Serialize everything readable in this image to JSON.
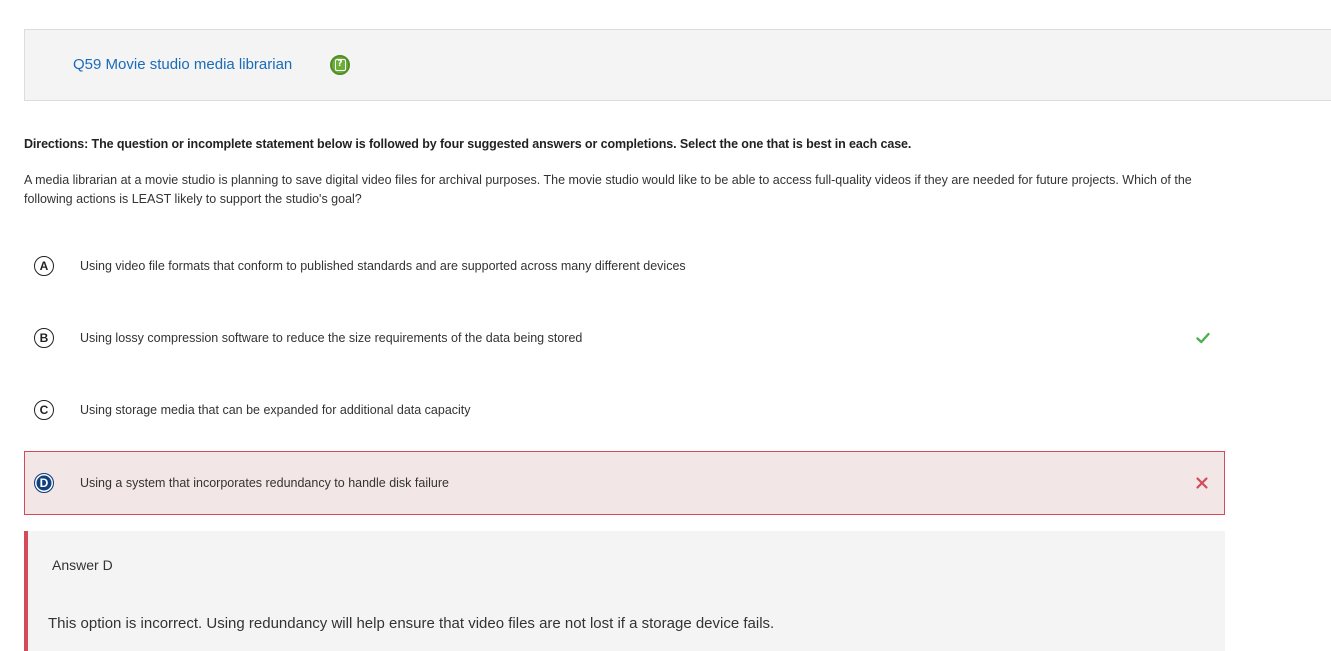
{
  "question": {
    "title": "Q59 Movie studio media librarian",
    "help_icon": "help-icon"
  },
  "directions": "Directions: The question or incomplete statement below is followed by four suggested answers or completions. Select the one that is best in each case.",
  "stem": "A media librarian at a movie studio is planning to save digital video files for archival purposes. The movie studio would like to be able to access full-quality videos if they are needed for future projects. Which of the following actions is LEAST likely to support the studio's goal?",
  "options": [
    {
      "letter": "A",
      "text": "Using video file formats that conform to published standards and are supported across many different devices"
    },
    {
      "letter": "B",
      "text": "Using lossy compression software to reduce the size requirements of the data being stored",
      "correct": true
    },
    {
      "letter": "C",
      "text": "Using storage media that can be expanded for additional data capacity"
    },
    {
      "letter": "D",
      "text": "Using a system that incorporates redundancy to handle disk failure",
      "selected": true,
      "wrong": true
    }
  ],
  "feedback": {
    "title": "Answer D",
    "text": "This option is incorrect. Using redundancy will help ensure that video files are not lost if a storage device fails."
  },
  "colors": {
    "link": "#1a6bb8",
    "correct": "#4caf50",
    "wrong": "#d34a5b",
    "selected_badge": "#123f7d"
  }
}
